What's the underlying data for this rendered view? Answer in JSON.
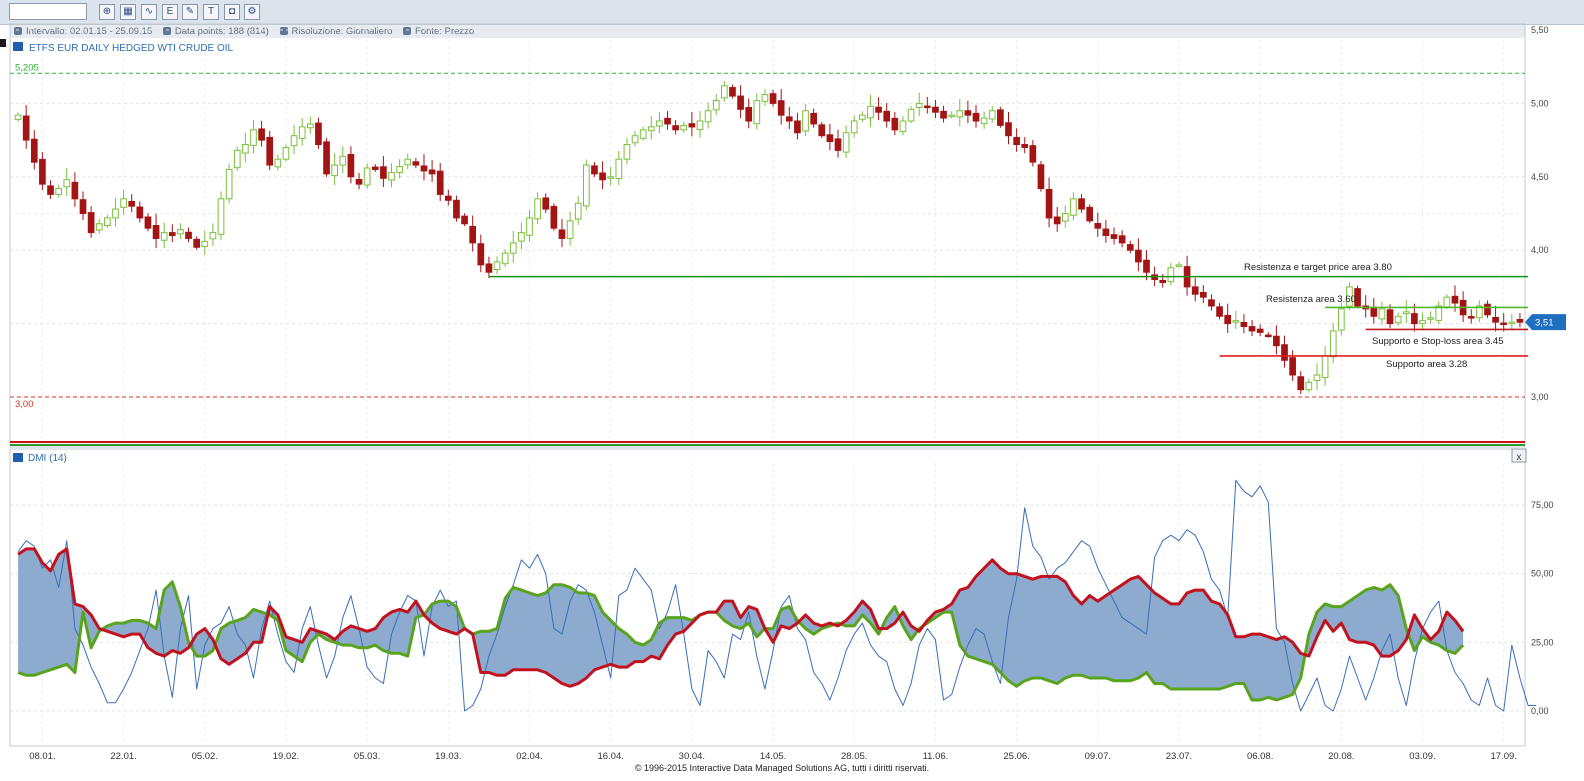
{
  "toolbar": {
    "input_value": "",
    "buttons": [
      "zoom-icon",
      "zoom-range-icon",
      "line-chart-icon",
      "indicator-icon",
      "drawing-icon",
      "text-icon",
      "annotation-icon",
      "settings-icon"
    ]
  },
  "infobar": {
    "interval": "Intervallo: 02.01.15 - 25.09.15",
    "datapoints": "Data points: 188 (814)",
    "resolution": "Risoluzione: Giornaliero",
    "source": "Fonte: Prezzo"
  },
  "footer": "© 1996-2015 Interactive Data Managed Solutions AG, tutti i diritti riservati.",
  "colors": {
    "up": "#7bbf3d",
    "down": "#a31515",
    "dmi_fill": "#86a6cc",
    "adx": "#3a6eb8",
    "plus_di": "#5aa31f",
    "minus_di": "#c1121f",
    "price_tag": "#1f6fbf"
  },
  "chart_data": [
    {
      "type": "candlestick",
      "title": "ETFS EUR DAILY HEDGED WTI CRUDE OIL",
      "ylim": [
        2.65,
        5.5
      ],
      "y_ticks": [
        "5,50",
        "5,00",
        "4,50",
        "4,00",
        "3,51",
        "3,00"
      ],
      "x_ticks": [
        "08.01.",
        "22.01.",
        "05.02.",
        "19.02.",
        "05.03.",
        "19.03.",
        "02.04.",
        "16.04.",
        "30.04.",
        "14.05.",
        "28.05.",
        "11.06.",
        "25.06.",
        "09.07.",
        "23.07.",
        "06.08.",
        "20.08.",
        "03.09.",
        "17.09."
      ],
      "last_price": "3,51",
      "ref_lines": [
        {
          "label": "5,205",
          "y": 5.205,
          "color": "#33b233"
        },
        {
          "label": "3,00",
          "y": 3.0,
          "color": "#d9342b"
        }
      ],
      "annotations": [
        {
          "text": "Resistenza e target price area 3.80",
          "y": 3.82,
          "from_day": 101,
          "to_day": 186,
          "color": "#149414"
        },
        {
          "text": "Resistenza area 3.60",
          "y": 3.61,
          "from_day": 161,
          "to_day": 186,
          "color": "#4fb82b"
        },
        {
          "text": "Supporto e Stop-loss area 3.45",
          "y": 3.46,
          "from_day": 166,
          "to_day": 186,
          "color": "#c21a1a"
        },
        {
          "text": "Supporto area 3.28",
          "y": 3.28,
          "from_day": 148,
          "to_day": 186,
          "color": "#e02020"
        }
      ],
      "closes": [
        4.92,
        4.75,
        4.6,
        4.45,
        4.38,
        4.42,
        4.48,
        4.35,
        4.25,
        4.12,
        4.18,
        4.22,
        4.28,
        4.35,
        4.3,
        4.22,
        4.15,
        4.08,
        4.12,
        4.1,
        4.14,
        4.08,
        4.02,
        4.06,
        4.12,
        4.35,
        4.55,
        4.68,
        4.72,
        4.82,
        4.75,
        4.58,
        4.62,
        4.7,
        4.78,
        4.84,
        4.86,
        4.72,
        4.52,
        4.58,
        4.64,
        4.5,
        4.45,
        4.56,
        4.55,
        4.49,
        4.53,
        4.57,
        4.62,
        4.58,
        4.54,
        4.52,
        4.38,
        4.34,
        4.22,
        4.18,
        4.05,
        3.9,
        3.85,
        3.92,
        3.98,
        4.05,
        4.12,
        4.22,
        4.35,
        4.28,
        4.15,
        4.08,
        4.2,
        4.32,
        4.58,
        4.52,
        4.48,
        4.5,
        4.62,
        4.72,
        4.78,
        4.82,
        4.84,
        4.88,
        4.86,
        4.82,
        4.85,
        4.84,
        4.88,
        4.95,
        5.02,
        5.12,
        5.05,
        4.96,
        4.88,
        5.02,
        5.06,
        5.0,
        4.92,
        4.88,
        4.8,
        4.95,
        4.86,
        4.78,
        4.74,
        4.68,
        4.8,
        4.88,
        4.92,
        4.98,
        4.94,
        4.88,
        4.82,
        4.88,
        4.96,
        5.0,
        4.98,
        4.94,
        4.9,
        4.92,
        4.95,
        4.92,
        4.88,
        4.9,
        4.95,
        4.85,
        4.78,
        4.72,
        4.7,
        4.6,
        4.42,
        4.22,
        4.18,
        4.25,
        4.35,
        4.28,
        4.2,
        4.15,
        4.1,
        4.08,
        4.05,
        4.0,
        3.92,
        3.85,
        3.8,
        3.78,
        3.88,
        3.9,
        3.75,
        3.7,
        3.68,
        3.62,
        3.55,
        3.5,
        3.52,
        3.48,
        3.45,
        3.44,
        3.42,
        3.35,
        3.25,
        3.15,
        3.05,
        3.1,
        3.15,
        3.28,
        3.45,
        3.6,
        3.75,
        3.62,
        3.6,
        3.55,
        3.6,
        3.5,
        3.55,
        3.58,
        3.5,
        3.52,
        3.54,
        3.62,
        3.68,
        3.64,
        3.56,
        3.54,
        3.62,
        3.56,
        3.51,
        3.5,
        3.51,
        3.51
      ],
      "dmi": {
        "name": "DMI (14)",
        "ylim": [
          -10,
          90
        ],
        "y_ticks": [
          "75,00",
          "50,00",
          "25,00",
          "0,00"
        ],
        "adx": [
          58,
          62,
          60,
          52,
          55,
          45,
          62,
          30,
          24,
          16,
          10,
          3,
          3,
          8,
          14,
          22,
          30,
          44,
          20,
          5,
          30,
          42,
          8,
          24,
          30,
          32,
          38,
          28,
          24,
          12,
          30,
          40,
          28,
          18,
          14,
          30,
          38,
          24,
          12,
          20,
          34,
          42,
          30,
          16,
          12,
          10,
          28,
          36,
          42,
          40,
          20,
          38,
          44,
          38,
          40,
          0,
          2,
          8,
          20,
          28,
          38,
          46,
          55,
          52,
          57,
          50,
          30,
          28,
          40,
          46,
          44,
          36,
          24,
          12,
          42,
          44,
          52,
          48,
          44,
          30,
          36,
          46,
          28,
          8,
          2,
          22,
          18,
          12,
          28,
          26,
          36,
          20,
          8,
          22,
          38,
          42,
          30,
          26,
          14,
          10,
          4,
          12,
          22,
          28,
          32,
          24,
          20,
          18,
          8,
          2,
          10,
          24,
          30,
          26,
          4,
          6,
          16,
          24,
          30,
          28,
          18,
          10,
          34,
          48,
          74,
          60,
          56,
          48,
          52,
          54,
          58,
          62,
          60,
          52,
          46,
          40,
          34,
          32,
          30,
          28,
          56,
          62,
          64,
          62,
          66,
          64,
          58,
          48,
          44,
          34,
          84,
          80,
          78,
          82,
          76,
          30,
          25,
          10,
          0,
          6,
          12,
          2,
          0,
          8,
          20,
          12,
          4,
          12,
          22,
          28,
          12,
          2,
          18,
          30,
          36,
          40,
          22,
          14,
          10,
          4,
          2,
          12,
          2,
          0,
          24,
          12,
          2,
          2
        ],
        "plus_di": [
          14,
          13,
          13,
          14,
          15,
          16,
          17,
          14,
          36,
          23,
          29,
          31,
          32,
          32,
          33,
          33,
          32,
          30,
          44,
          47,
          38,
          25,
          20,
          20,
          22,
          30,
          32,
          33,
          34,
          37,
          36,
          35,
          33,
          22,
          20,
          18,
          25,
          28,
          26,
          25,
          24,
          24,
          23,
          23,
          24,
          22,
          21,
          21,
          20,
          34,
          35,
          39,
          40,
          40,
          38,
          30,
          28,
          29,
          29,
          30,
          41,
          45,
          44,
          43,
          42,
          43,
          46,
          46,
          45,
          43,
          43,
          42,
          36,
          33,
          30,
          28,
          25,
          24,
          26,
          32,
          34,
          34,
          34,
          33,
          35,
          36,
          36,
          33,
          31,
          30,
          32,
          27,
          30,
          30,
          37,
          38,
          33,
          30,
          28,
          30,
          31,
          32,
          31,
          31,
          35,
          32,
          28,
          34,
          38,
          31,
          26,
          30,
          32,
          34,
          36,
          36,
          24,
          20,
          19,
          18,
          17,
          14,
          11,
          9,
          11,
          12,
          12,
          11,
          10,
          12,
          13,
          13,
          12,
          12,
          12,
          11,
          11,
          11,
          12,
          14,
          10,
          10,
          8,
          8,
          8,
          8,
          8,
          8,
          8,
          9,
          10,
          10,
          4,
          4,
          5,
          4,
          5,
          6,
          12,
          28,
          36,
          39,
          38,
          38,
          40,
          42,
          44,
          45,
          44,
          46,
          42,
          30,
          22,
          27,
          25,
          24,
          22,
          21,
          24
        ],
        "minus_di": [
          57,
          59,
          59,
          54,
          51,
          57,
          59,
          39,
          38,
          35,
          30,
          29,
          28,
          27,
          28,
          28,
          23,
          21,
          20,
          22,
          21,
          23,
          28,
          30,
          26,
          19,
          17,
          19,
          21,
          25,
          25,
          38,
          35,
          27,
          26,
          25,
          30,
          29,
          28,
          26,
          29,
          31,
          30,
          29,
          30,
          34,
          36,
          37,
          36,
          40,
          35,
          32,
          30,
          29,
          28,
          30,
          28,
          14,
          14,
          13,
          13,
          15,
          15,
          15,
          15,
          14,
          12,
          10,
          9,
          10,
          12,
          15,
          16,
          17,
          16,
          16,
          18,
          18,
          20,
          19,
          24,
          28,
          29,
          32,
          35,
          36,
          36,
          40,
          40,
          34,
          38,
          37,
          30,
          25,
          31,
          30,
          32,
          35,
          32,
          31,
          32,
          31,
          33,
          36,
          40,
          37,
          30,
          30,
          32,
          36,
          31,
          29,
          33,
          36,
          37,
          39,
          44,
          45,
          49,
          52,
          55,
          52,
          50,
          50,
          49,
          48,
          49,
          49,
          49,
          47,
          42,
          39,
          42,
          40,
          42,
          44,
          46,
          48,
          49,
          46,
          43,
          41,
          39,
          39,
          43,
          44,
          44,
          40,
          39,
          35,
          27,
          27,
          28,
          28,
          27,
          26,
          27,
          25,
          21,
          20,
          27,
          33,
          29,
          32,
          26,
          25,
          25,
          24,
          20,
          20,
          22,
          26,
          35,
          30,
          26,
          29,
          36,
          33,
          29
        ]
      }
    }
  ]
}
